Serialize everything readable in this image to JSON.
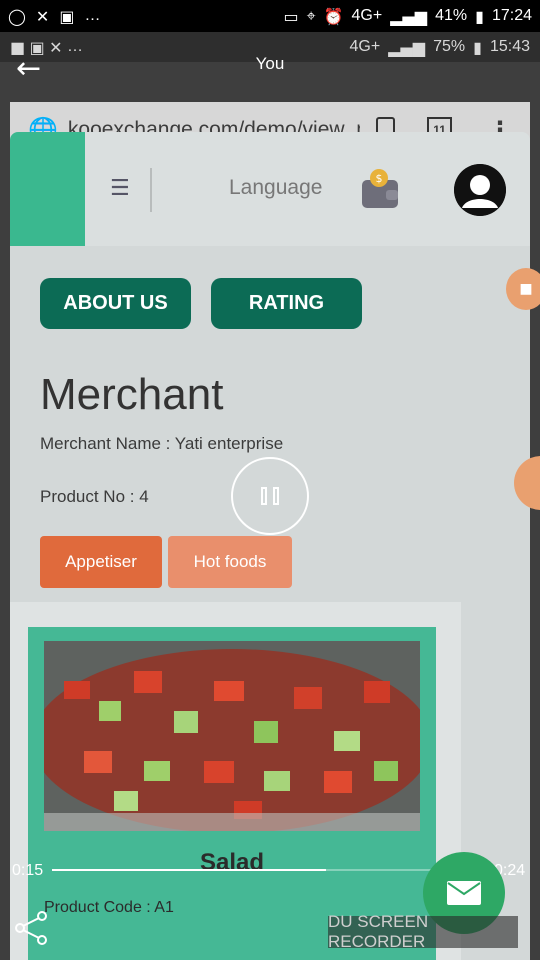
{
  "outer_status": {
    "battery": "41%",
    "time": "17:24",
    "network": "4G+"
  },
  "inner_status": {
    "battery": "75%",
    "time": "15:43",
    "network": "4G+"
  },
  "topbar": {
    "title": "You"
  },
  "browser": {
    "url": "kooexchange.com/demo/view_me",
    "tab_count": "11"
  },
  "site_nav": {
    "language_label": "Language"
  },
  "buttons": {
    "about": "ABOUT US",
    "rating": "RATING"
  },
  "merchant": {
    "heading": "Merchant",
    "name_line": "Merchant Name : Yati enterprise",
    "product_line": "Product No : 4"
  },
  "categories": [
    {
      "label": "Appetiser",
      "active": true
    },
    {
      "label": "Hot foods",
      "active": false
    }
  ],
  "product": {
    "title": "Salad",
    "code_line": "Product Code : A1"
  },
  "player": {
    "elapsed": "0:15",
    "duration": "0:24",
    "progress": 0.625
  },
  "watermark": "DU SCREEN RECORDER",
  "colors": {
    "brand_green": "#0c6b55",
    "accent_orange": "#e06a3c",
    "card_green": "#45b895"
  }
}
